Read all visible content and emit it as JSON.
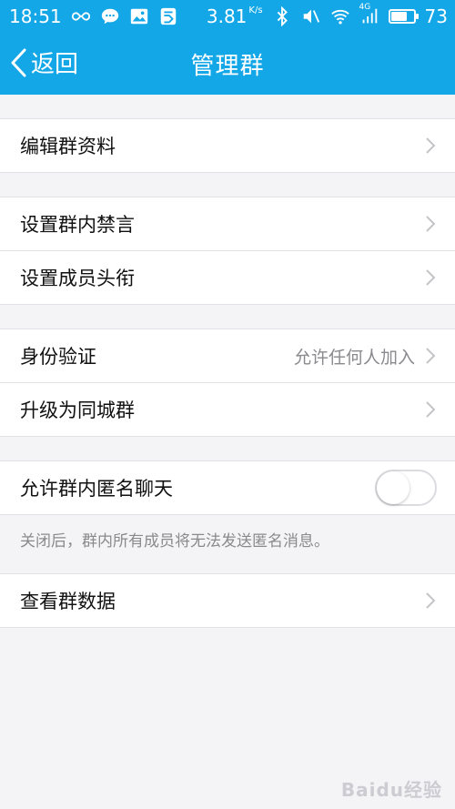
{
  "status_bar": {
    "time": "18:51",
    "speed": "3.81",
    "speed_unit": "K/s",
    "network_label": "4G",
    "battery_level": "73",
    "battery_percent": 73,
    "icons": [
      "infinity-icon",
      "wechat-icon",
      "image-icon",
      "app-icon",
      "bluetooth-icon",
      "mute-icon",
      "wifi-icon",
      "signal-icon",
      "battery-icon"
    ]
  },
  "navbar": {
    "back_label": "返回",
    "title": "管理群"
  },
  "sections": {
    "edit_profile": "编辑群资料",
    "mute_members": "设置群内禁言",
    "member_titles": "设置成员头衔",
    "verification_label": "身份验证",
    "verification_value": "允许任何人加入",
    "upgrade_city": "升级为同城群",
    "anonymous_chat": "允许群内匿名聊天",
    "anonymous_hint": "关闭后，群内所有成员将无法发送匿名消息。",
    "view_data": "查看群数据"
  },
  "toggle": {
    "anonymous_on": false
  },
  "watermark": "Baidu经验",
  "colors": {
    "accent": "#14a7e8",
    "background": "#f4f4f7",
    "row_bg": "#ffffff",
    "secondary_text": "#8a8a8e"
  }
}
